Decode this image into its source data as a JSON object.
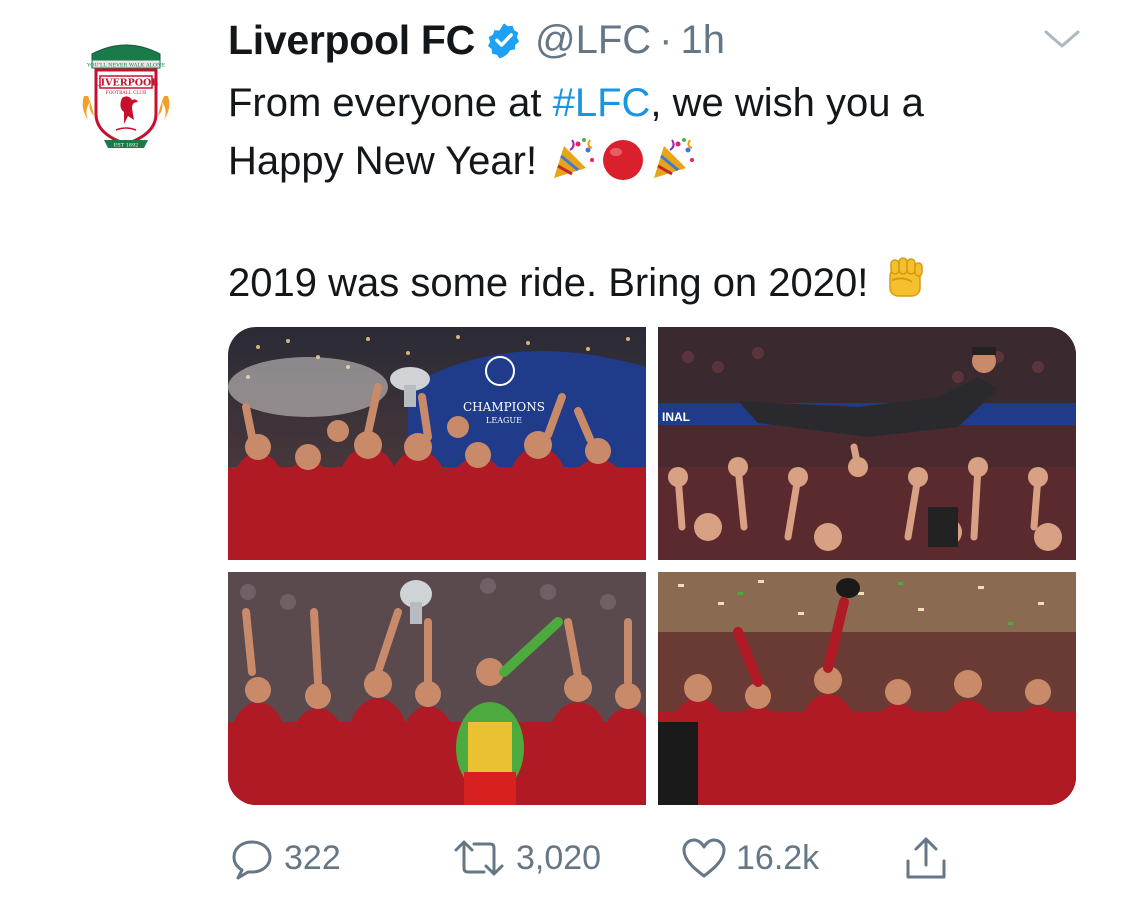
{
  "tweet": {
    "author_name": "Liverpool FC",
    "handle": "@LFC",
    "separator": "·",
    "time": "1h",
    "text_line1_pre": "From everyone at ",
    "hashtag": "#LFC",
    "text_line1_post": ", we wish you a",
    "text_line2": "Happy New Year! ",
    "text_line3": "2019 was some ride. Bring on 2020! ",
    "emojis": [
      "party-popper",
      "red-circle",
      "party-popper",
      "raised-fist"
    ]
  },
  "avatar": {
    "logo_top_banner": "YOU'LL NEVER WALK ALONE",
    "logo_name": "LIVERPOOL",
    "logo_sub": "FOOTBALL CLUB",
    "logo_est": "EST 1892"
  },
  "media": {
    "count": 4,
    "banner_text_1": "CHAMPIONS",
    "banner_text_2": "LEAGUE",
    "banner_text_3": "INAL"
  },
  "actions": {
    "replies": "322",
    "retweets": "3,020",
    "likes": "16.2k"
  },
  "colors": {
    "link": "#1b95e0",
    "muted": "#657786",
    "text": "#14171a",
    "verified": "#1da1f2",
    "lfc_red": "#c8102e"
  }
}
